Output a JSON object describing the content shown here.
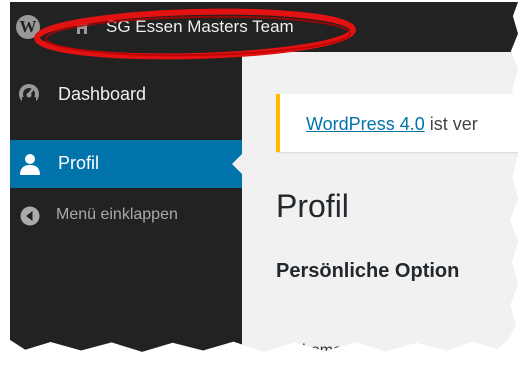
{
  "adminbar": {
    "logo_glyph": "W",
    "site_name": "SG Essen Masters Team",
    "highlight_color": "#e31212"
  },
  "sidebar": {
    "items": [
      {
        "label": "Dashboard",
        "icon": "dashboard-gauge-icon"
      },
      {
        "label": "Profil",
        "icon": "user-icon",
        "active": true
      },
      {
        "label": "Menü einklappen",
        "icon": "collapse-arrow-icon"
      }
    ]
  },
  "content": {
    "notice": {
      "link_text": "WordPress 4.0",
      "rest": " ist ver"
    },
    "page_title": "Profil",
    "section_heading": "Persönliche Option",
    "cutoff_text": "hema"
  },
  "colors": {
    "adminbar_bg": "#222222",
    "sidebar_active": "#0073aa",
    "notice_border": "#ffba00",
    "link": "#0073aa",
    "content_bg": "#f1f1f1"
  }
}
